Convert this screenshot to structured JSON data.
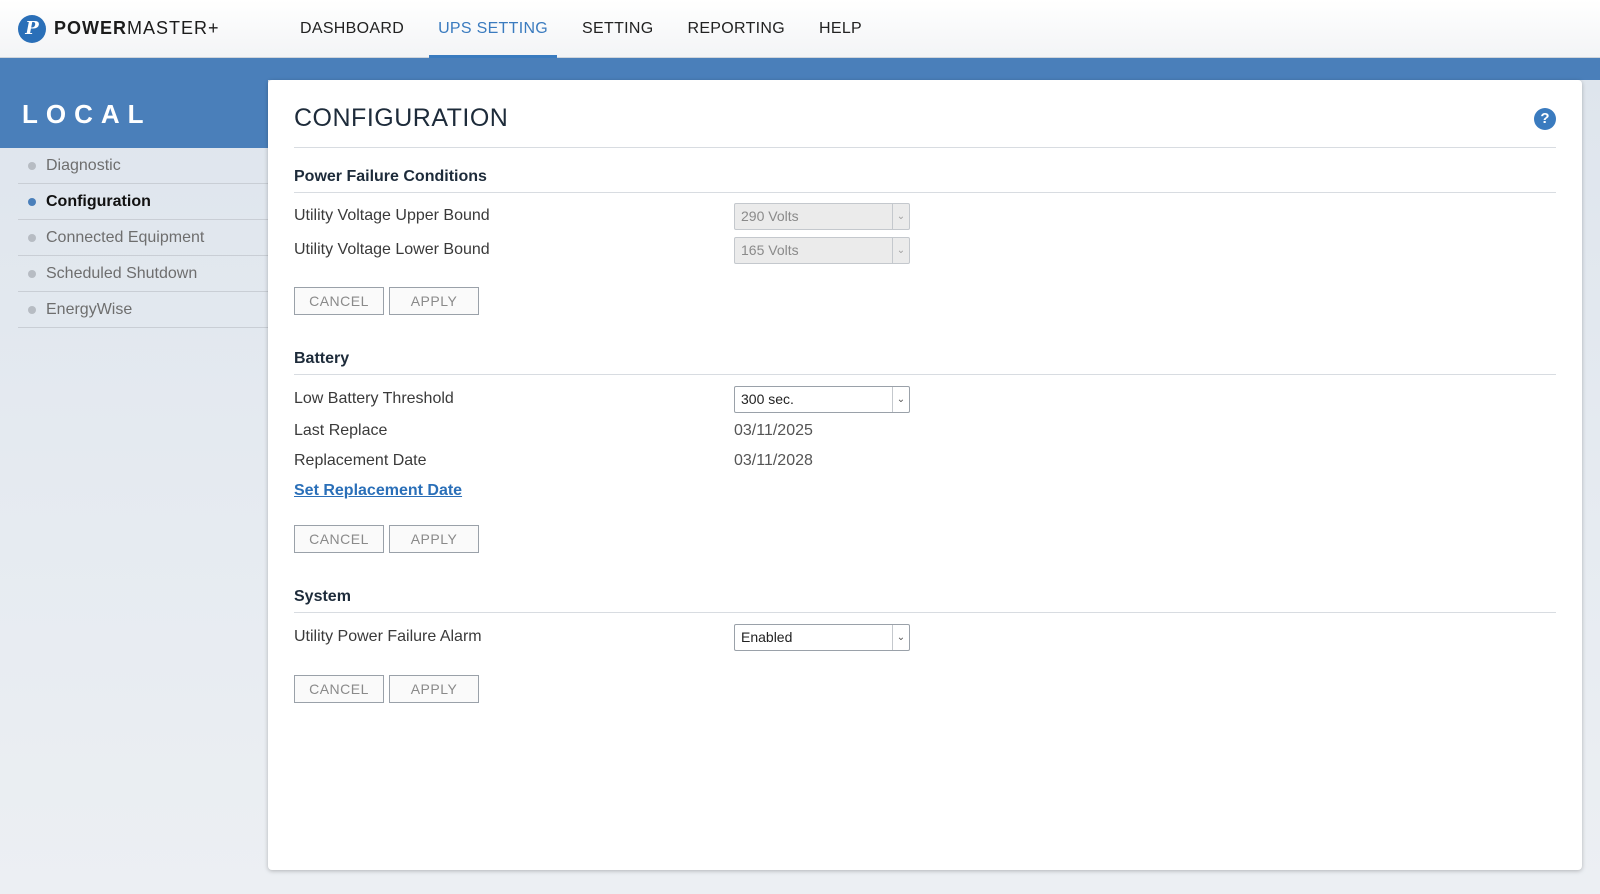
{
  "brand": {
    "logo_letter": "P",
    "name_bold": "POWER",
    "name_rest": "MASTER+"
  },
  "nav": {
    "items": [
      {
        "label": "DASHBOARD",
        "active": false
      },
      {
        "label": "UPS SETTING",
        "active": true
      },
      {
        "label": "SETTING",
        "active": false
      },
      {
        "label": "REPORTING",
        "active": false
      },
      {
        "label": "HELP",
        "active": false
      }
    ]
  },
  "sidebar": {
    "heading": "LOCAL",
    "items": [
      {
        "label": "Diagnostic",
        "active": false
      },
      {
        "label": "Configuration",
        "active": true
      },
      {
        "label": "Connected Equipment",
        "active": false
      },
      {
        "label": "Scheduled Shutdown",
        "active": false
      },
      {
        "label": "EnergyWise",
        "active": false
      }
    ]
  },
  "main": {
    "title": "CONFIGURATION",
    "help_icon": "?",
    "power_failure": {
      "title": "Power Failure Conditions",
      "upper_label": "Utility Voltage Upper Bound",
      "upper_value": "290 Volts",
      "lower_label": "Utility Voltage Lower Bound",
      "lower_value": "165 Volts",
      "cancel": "CANCEL",
      "apply": "APPLY"
    },
    "battery": {
      "title": "Battery",
      "threshold_label": "Low Battery Threshold",
      "threshold_value": "300 sec.",
      "last_replace_label": "Last Replace",
      "last_replace_value": "03/11/2025",
      "replacement_label": "Replacement Date",
      "replacement_value": "03/11/2028",
      "set_link": "Set Replacement Date",
      "cancel": "CANCEL",
      "apply": "APPLY"
    },
    "system": {
      "title": "System",
      "alarm_label": "Utility Power Failure Alarm",
      "alarm_value": "Enabled",
      "cancel": "CANCEL",
      "apply": "APPLY"
    }
  },
  "icons": {
    "dropdown": "chevron-down-icon",
    "help": "help-icon",
    "bullet": "bullet-icon"
  },
  "colors": {
    "accent": "#3a7bbf",
    "band": "#4a7fba",
    "link": "#2a6fb8"
  }
}
